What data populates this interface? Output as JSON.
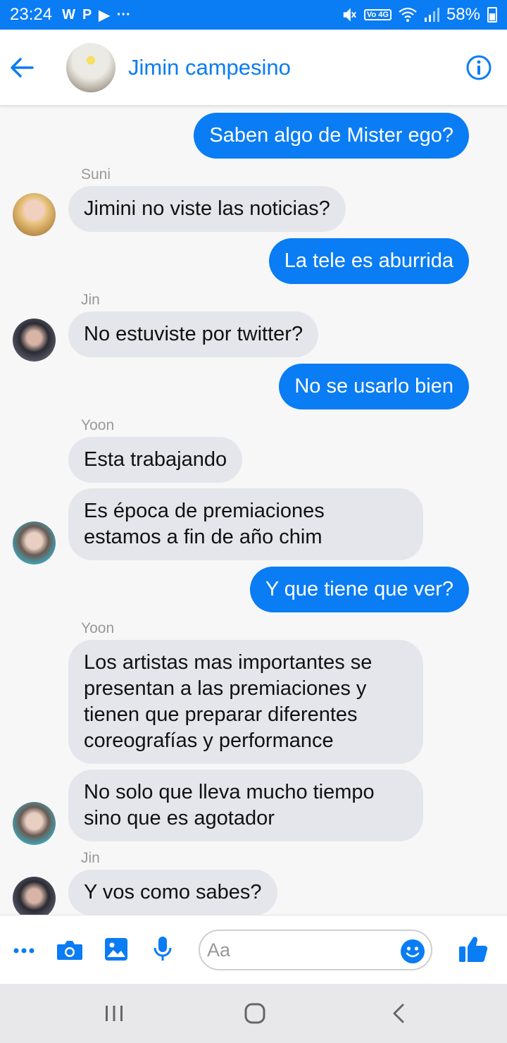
{
  "status_bar": {
    "time": "23:24",
    "app_icons": [
      "W",
      "P",
      "▶",
      "···"
    ],
    "network_badge": "Vo 4G",
    "battery_percent": "58%",
    "battery_badge": "7"
  },
  "header": {
    "title": "Jimin campesino",
    "accent_color": "#0a7cf4"
  },
  "messages": [
    {
      "direction": "outgoing",
      "text": "Saben algo de Mister ego?"
    },
    {
      "direction": "incoming",
      "sender": "Suni",
      "text": "Jimini no viste las noticias?"
    },
    {
      "direction": "outgoing",
      "text": "La tele es aburrida"
    },
    {
      "direction": "incoming",
      "sender": "Jin",
      "text": "No estuviste por twitter?"
    },
    {
      "direction": "outgoing",
      "text": "No se usarlo bien"
    },
    {
      "direction": "incoming",
      "sender": "Yoon",
      "text": "Esta trabajando"
    },
    {
      "direction": "incoming",
      "text_lines": [
        "Es época de premiaciones",
        "estamos a fin de año chim"
      ]
    },
    {
      "direction": "outgoing",
      "text": "Y que tiene que ver?"
    },
    {
      "direction": "incoming",
      "sender": "Yoon",
      "text_lines": [
        "Los artistas mas importantes se",
        "presentan a las premiaciones y",
        "tienen que preparar diferentes",
        "coreografías y performance"
      ]
    },
    {
      "direction": "incoming",
      "text_lines": [
        "No solo que lleva mucho tiempo",
        "sino que es agotador"
      ]
    },
    {
      "direction": "incoming",
      "sender": "Jin",
      "text": "Y vos como sabes?"
    }
  ],
  "composer": {
    "placeholder": "Aa",
    "value": ""
  },
  "icons": {
    "back": "arrow-left-icon",
    "info": "info-icon",
    "more": "more-icon",
    "camera": "camera-icon",
    "gallery": "image-icon",
    "mic": "microphone-icon",
    "emoji": "smiley-icon",
    "like": "thumbs-up-icon"
  }
}
